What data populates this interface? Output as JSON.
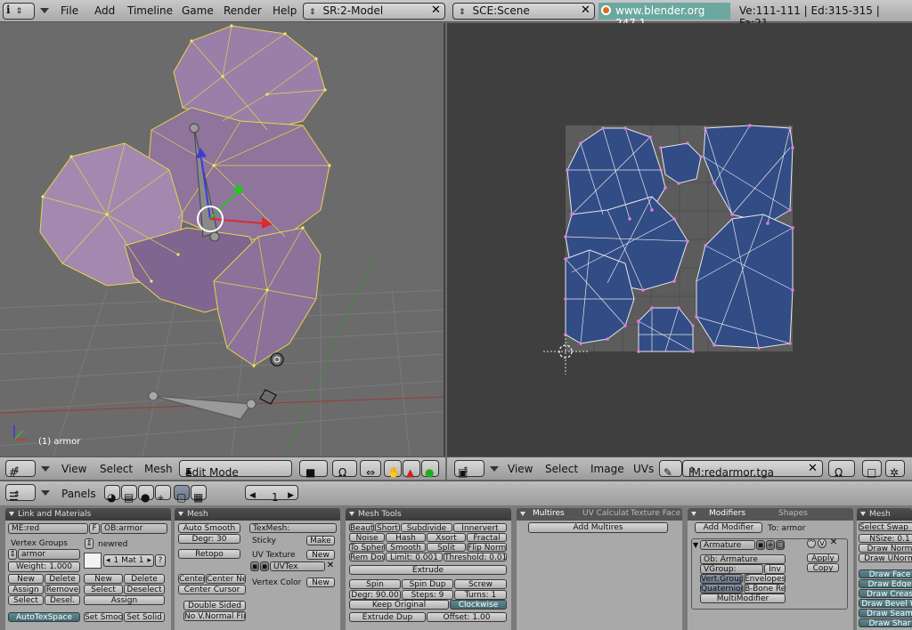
{
  "topbar": {
    "menus": [
      "File",
      "Add",
      "Timeline",
      "Game",
      "Render",
      "Help"
    ],
    "screen": "SR:2-Model",
    "scene": "SCE:Scene",
    "url": "www.blender.org 247.1",
    "stats": "Ve:111-111 | Ed:315-315 | Fa:21"
  },
  "viewport3d": {
    "object_label": "(1) armor",
    "header": {
      "view": "View",
      "select": "Select",
      "mesh": "Mesh",
      "mode": "Edit Mode"
    }
  },
  "uv_editor": {
    "header": {
      "view": "View",
      "select": "Select",
      "image": "Image",
      "uvs": "UVs",
      "image_name": "IM:redarmor.tga"
    }
  },
  "buttons_header": {
    "panels": "Panels",
    "frame": "1"
  },
  "link_materials": {
    "title": "Link and Materials",
    "me": "ME:red",
    "f": "F",
    "ob": "OB:armor",
    "vertex_groups": "Vertex Groups",
    "group_name": "armor",
    "weight": "Weight: 1.000",
    "new": "New",
    "delete": "Delete",
    "assign": "Assign",
    "remove": "Remove",
    "select": "Select",
    "desel": "Desel.",
    "mat_name": "newred",
    "mat_count": "1 Mat 1",
    "mat_q": "?",
    "new2": "New",
    "delete2": "Delete",
    "select2": "Select",
    "deselect": "Deselect",
    "assign2": "Assign",
    "autotex": "AutoTexSpace",
    "set_smooth": "Set Smoot",
    "set_solid": "Set Solid"
  },
  "mesh": {
    "title": "Mesh",
    "auto_smooth": "Auto Smooth",
    "degr": "Degr: 30",
    "retopo": "Retopo",
    "center": "Center",
    "center_new": "Center New",
    "center_cursor": "Center Cursor",
    "double_sided": "Double Sided",
    "no_vnormal": "No V.Normal Flip",
    "texmesh": "TexMesh:",
    "sticky": "Sticky",
    "make": "Make",
    "uv_texture": "UV Texture",
    "new": "New",
    "uvtex": "UVTex",
    "vertex_color": "Vertex Color",
    "new2": "New"
  },
  "mesh_tools": {
    "title": "Mesh Tools",
    "beauty": "Beauty",
    "short": "Short",
    "subdivide": "Subdivide",
    "innervert": "Innervert",
    "noise": "Noise",
    "hash": "Hash",
    "xsort": "Xsort",
    "fractal": "Fractal",
    "to_sphere": "To Sphere",
    "smooth": "Smooth",
    "split": "Split",
    "flip_normal": "Flip Normal",
    "rem_doubl": "Rem Doubl",
    "limit": "Limit: 0.001",
    "threshold": "Threshold: 0.010",
    "extrude": "Extrude",
    "spin": "Spin",
    "spin_dup": "Spin Dup",
    "screw": "Screw",
    "degr": "Degr: 90.00",
    "steps": "Steps: 9",
    "turns": "Turns: 1",
    "keep_original": "Keep Original",
    "clockwise": "Clockwise",
    "extrude_dup": "Extrude Dup",
    "offset": "Offset: 1.00"
  },
  "multires": {
    "tabs": [
      "Multires",
      "UV Calculat",
      "Texture Face"
    ],
    "add": "Add Multires"
  },
  "modifiers": {
    "tabs": [
      "Modifiers",
      "Shapes"
    ],
    "add": "Add Modifier",
    "to": "To: armor",
    "name": "Armature",
    "ob": "Ob: Armature",
    "vgroup": "VGroup:",
    "inv": "Inv",
    "vert_group": "Vert.Group",
    "envelopes": "Envelopes",
    "quaternion": "Quaternion",
    "bone_re": "B-Bone Re",
    "multimod": "MultiModifier",
    "apply": "Apply",
    "copy": "Copy"
  },
  "mesh_tools_more": {
    "title": "Mesh Tools",
    "select_swap": "Select Swap",
    "nsize": "NSize: 0.1",
    "draw_norm": "Draw Norm",
    "draw_unorm": "Draw UNorm",
    "draw_face": "Draw Face",
    "draw_edge": "Draw Edge",
    "draw_crease": "Draw Creas",
    "draw_bevel": "Draw Bevel W",
    "draw_seam": "Draw Seam",
    "draw_sharp": "Draw Shar"
  }
}
